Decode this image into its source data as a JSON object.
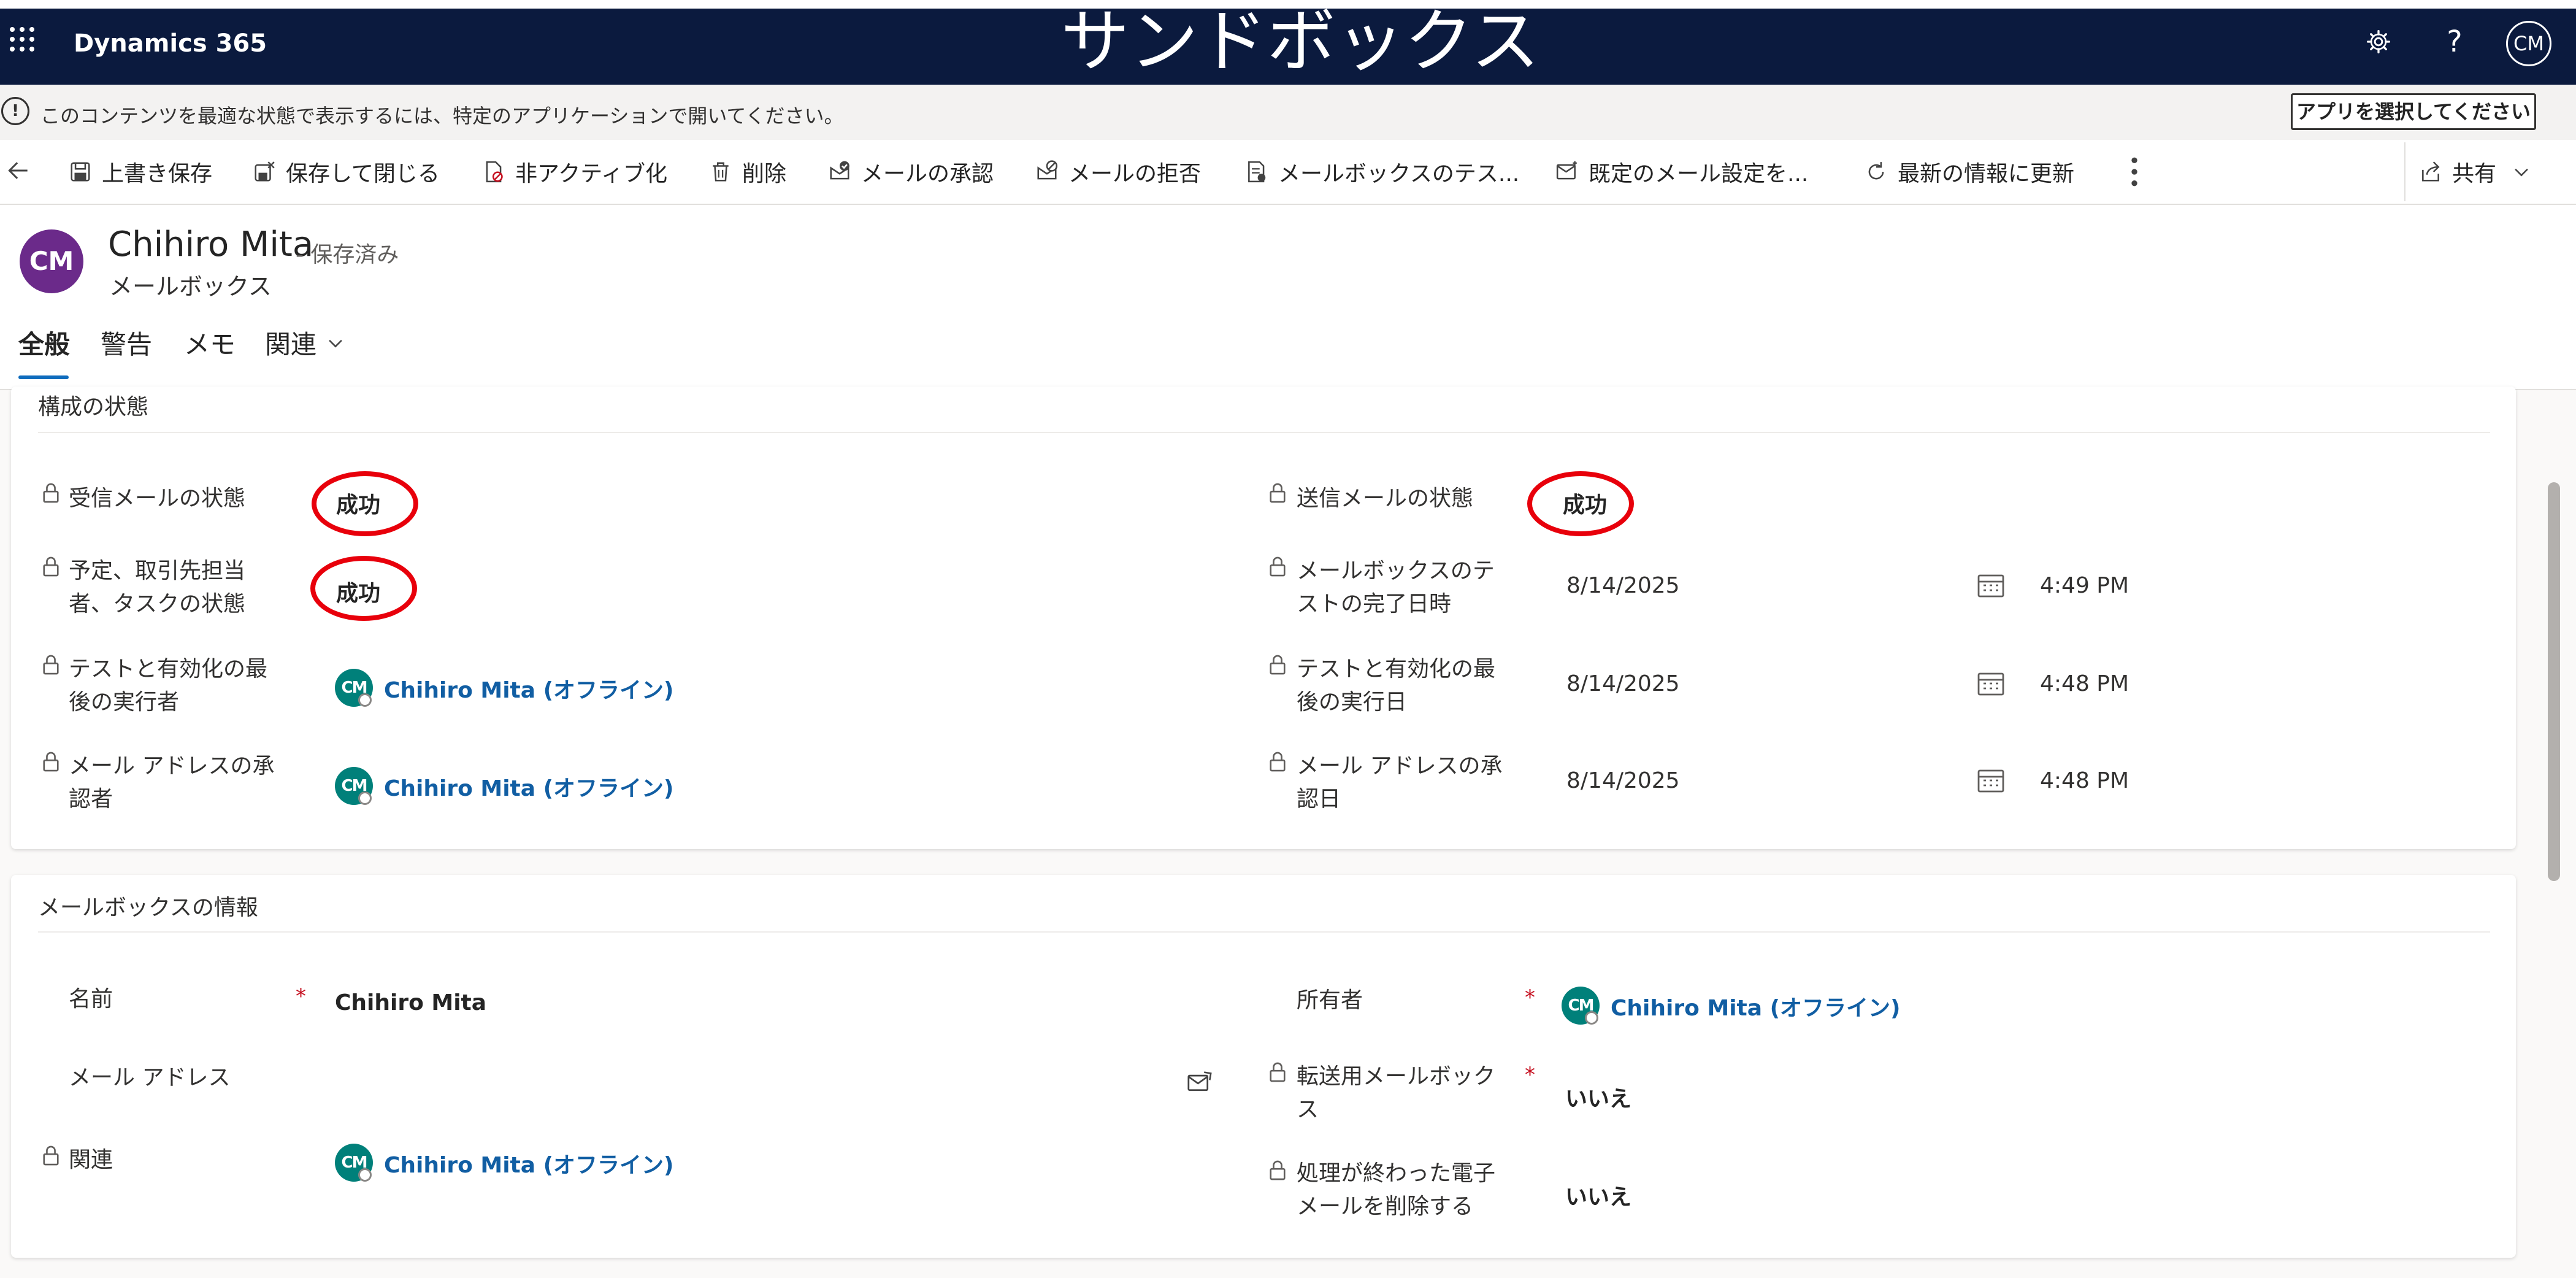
{
  "nav": {
    "app_name": "Dynamics 365",
    "environment_banner": "サンドボックス",
    "user_initials": "CM"
  },
  "info_bar": {
    "message": "このコンテンツを最適な状態で表示するには、特定のアプリケーションで開いてください。",
    "button": "アプリを選択してください"
  },
  "command_bar": {
    "items": [
      {
        "label": "上書き保存",
        "icon": "save-icon"
      },
      {
        "label": "保存して閉じる",
        "icon": "save-close-icon"
      },
      {
        "label": "非アクティブ化",
        "icon": "deactivate-icon"
      },
      {
        "label": "削除",
        "icon": "delete-icon"
      },
      {
        "label": "メールの承認",
        "icon": "approve-email-icon"
      },
      {
        "label": "メールの拒否",
        "icon": "reject-email-icon"
      },
      {
        "label": "メールボックスのテス...",
        "icon": "test-mailbox-icon"
      },
      {
        "label": "既定のメール設定を...",
        "icon": "email-settings-icon"
      },
      {
        "label": "最新の情報に更新",
        "icon": "refresh-icon"
      }
    ],
    "share": "共有"
  },
  "record": {
    "initials": "CM",
    "name": "Chihiro Mita",
    "status": "- 保存済み",
    "entity": "メールボックス",
    "tabs": [
      "全般",
      "警告",
      "メモ",
      "関連"
    ],
    "active_tab": "全般"
  },
  "config_section": {
    "title": "構成の状態",
    "incoming_label": "受信メールの状態",
    "incoming_value": "成功",
    "outgoing_label": "送信メールの状態",
    "outgoing_value": "成功",
    "appointments_label": "予定、取引先担当者、タスクの状態",
    "appointments_value": "成功",
    "test_completed_label": "メールボックスのテストの完了日時",
    "test_completed_date": "8/14/2025",
    "test_completed_time": "4:49 PM",
    "last_run_by_label": "テストと有効化の最後の実行者",
    "last_run_by_value": "Chihiro Mita (オフライン)",
    "last_run_on_label": "テストと有効化の最後の実行日",
    "last_run_on_date": "8/14/2025",
    "last_run_on_time": "4:48 PM",
    "approved_by_label": "メール アドレスの承認者",
    "approved_by_value": "Chihiro Mita (オフライン)",
    "approved_on_label": "メール アドレスの承認日",
    "approved_on_date": "8/14/2025",
    "approved_on_time": "4:48 PM"
  },
  "mailbox_section": {
    "title": "メールボックスの情報",
    "name_label": "名前",
    "name_value": "Chihiro Mita",
    "owner_label": "所有者",
    "owner_value": "Chihiro Mita (オフライン)",
    "email_label": "メール アドレス",
    "forward_label": "転送用メールボックス",
    "forward_value": "いいえ",
    "regarding_label": "関連",
    "regarding_value": "Chihiro Mita (オフライン)",
    "delete_label": "処理が終わった電子メールを削除する",
    "delete_value": "いいえ",
    "required_mark": "*",
    "person_initials": "CM"
  },
  "colors": {
    "nav_bg": "#0b1a3e",
    "avatar_purple": "#6b2a8a",
    "person_teal": "#00807a",
    "link_blue": "#115ea3",
    "annotation_red": "#e8000b",
    "required_red": "#c50f1f"
  }
}
